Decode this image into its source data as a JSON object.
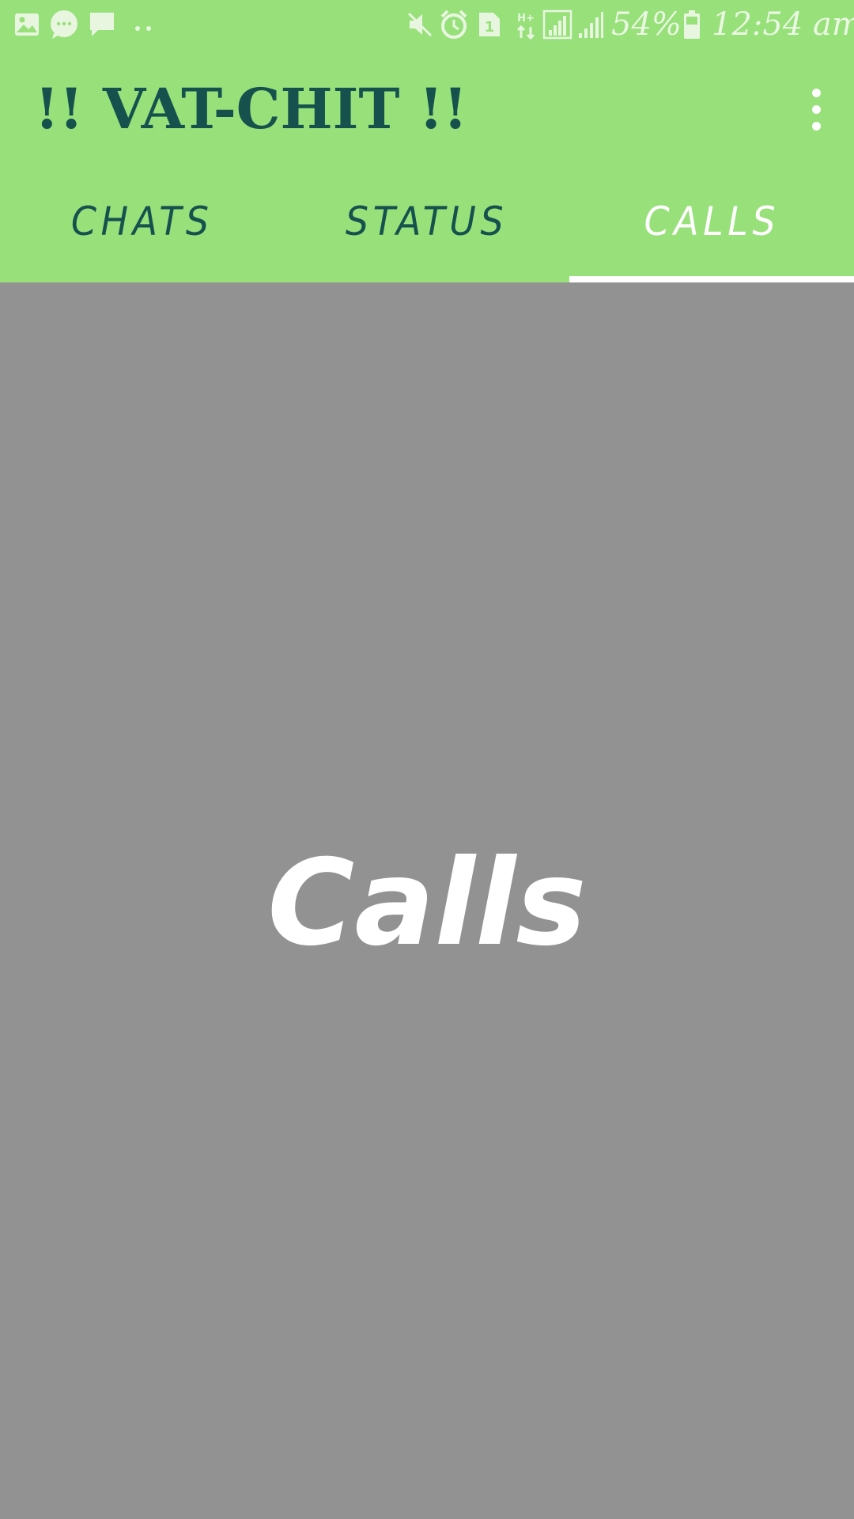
{
  "status_bar": {
    "left_icons": [
      "gallery-icon",
      "message-bubble-icon",
      "chat-icon",
      "more-dots-icon"
    ],
    "right_icons": [
      "mute-icon",
      "alarm-icon",
      "sim-1-icon",
      "data-arrows-icon",
      "signal-icon",
      "signal-2-icon",
      "battery-icon"
    ],
    "sim_label": "1",
    "data_label": "H+",
    "battery_text": "54%",
    "time": "12:54 am"
  },
  "app_bar": {
    "title": "!! VAT-CHIT !!",
    "menu_icon": "overflow-menu-icon"
  },
  "tabs": [
    {
      "label": "CHATS",
      "active": false
    },
    {
      "label": "STATUS",
      "active": false
    },
    {
      "label": "CALLS",
      "active": true
    }
  ],
  "content": {
    "label": "Calls"
  },
  "colors": {
    "app_bar_bg": "#97e07a",
    "title_color": "#16514e",
    "content_bg": "#929292",
    "active_tab": "#ffffff"
  }
}
